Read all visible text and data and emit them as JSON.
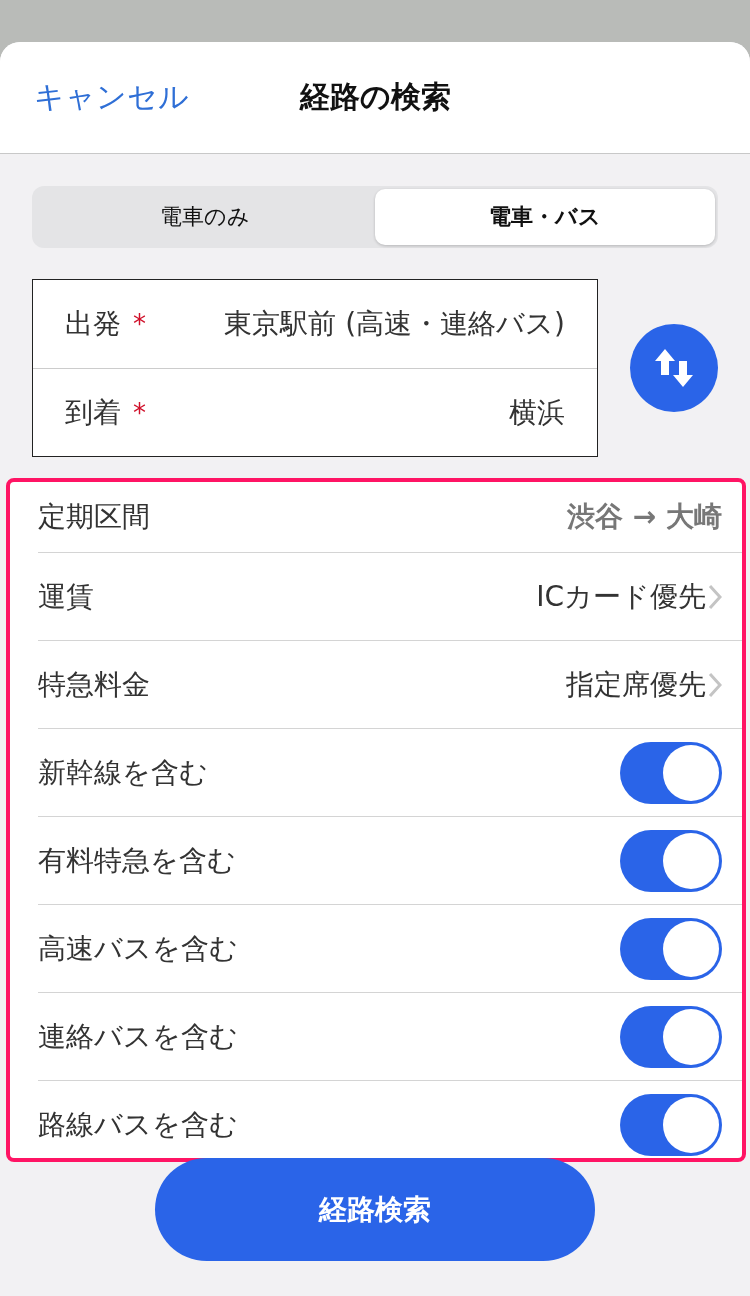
{
  "sheet": {
    "cancel": "キャンセル",
    "title": "経路の検索"
  },
  "segments": [
    {
      "label": "電車のみ",
      "selected": false
    },
    {
      "label": "電車・バス",
      "selected": true
    }
  ],
  "route": [
    {
      "label": "出発",
      "required": true,
      "value": "東京駅前 (高速・連絡バス)"
    },
    {
      "label": "到着",
      "required": true,
      "value": "横浜"
    }
  ],
  "required_mark": "*",
  "settings": [
    {
      "kind": "value",
      "label": "定期区間",
      "value": "渋谷 → 大崎"
    },
    {
      "kind": "link",
      "label": "運賃",
      "value": "ICカード優先"
    },
    {
      "kind": "link",
      "label": "特急料金",
      "value": "指定席優先"
    },
    {
      "kind": "toggle",
      "label": "新幹線を含む",
      "on": true
    },
    {
      "kind": "toggle",
      "label": "有料特急を含む",
      "on": true
    },
    {
      "kind": "toggle",
      "label": "高速バスを含む",
      "on": true
    },
    {
      "kind": "toggle",
      "label": "連絡バスを含む",
      "on": true
    },
    {
      "kind": "toggle",
      "label": "路線バスを含む",
      "on": true
    }
  ],
  "search_button": "経路検索"
}
